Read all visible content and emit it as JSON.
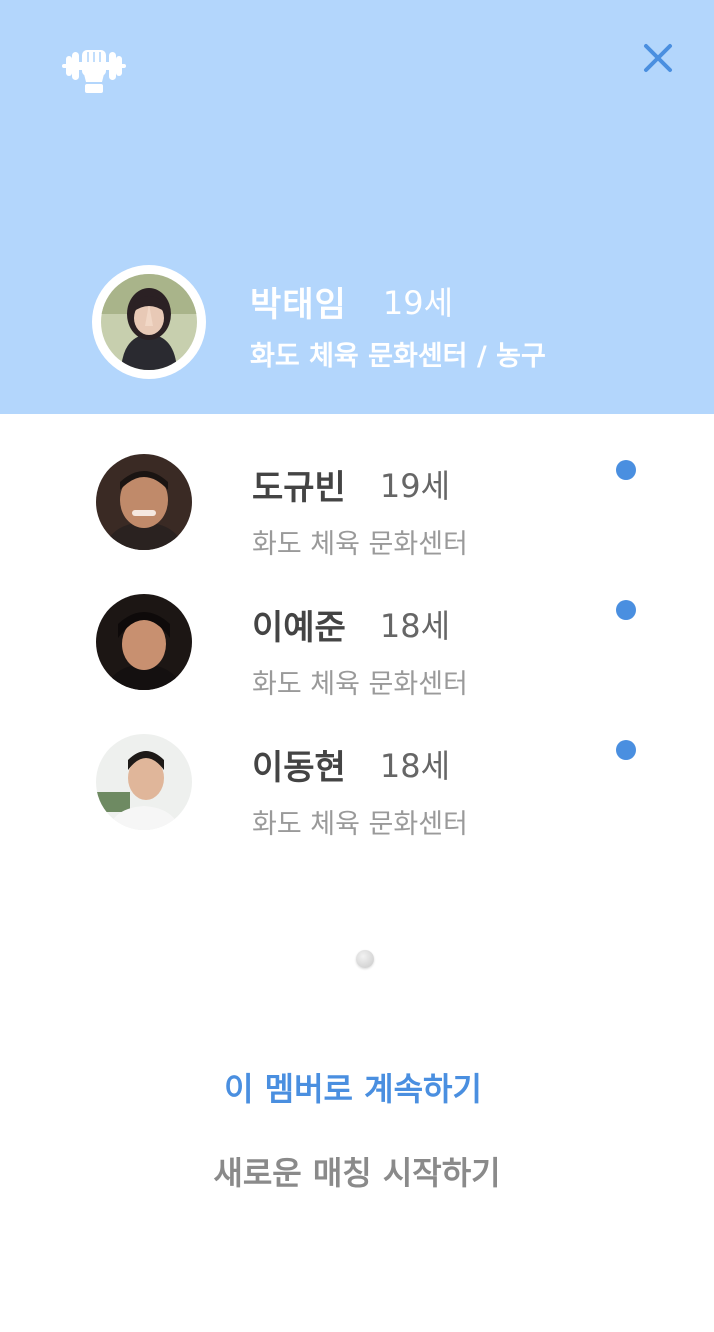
{
  "colors": {
    "header_bg": "#b3d6fc",
    "accent": "#4a8fe0",
    "name_text": "#444444",
    "sub_text": "#9a9a9a"
  },
  "header": {
    "logo_icon": "fist-dumbbell-logo-icon",
    "close_icon": "close-icon"
  },
  "me": {
    "name": "박태임",
    "age": "19세",
    "affiliation": "화도 체육 문화센터 / 농구"
  },
  "members": [
    {
      "name": "도규빈",
      "age": "19세",
      "affiliation": "화도 체육 문화센터",
      "status": "online"
    },
    {
      "name": "이예준",
      "age": "18세",
      "affiliation": "화도 체육 문화센터",
      "status": "online"
    },
    {
      "name": "이동현",
      "age": "18세",
      "affiliation": "화도 체육 문화센터",
      "status": "online"
    }
  ],
  "pagination": {
    "pages": 1,
    "current": 1
  },
  "actions": {
    "continue_label": "이 멤버로 계속하기",
    "new_match_label": "새로운 매칭 시작하기"
  }
}
